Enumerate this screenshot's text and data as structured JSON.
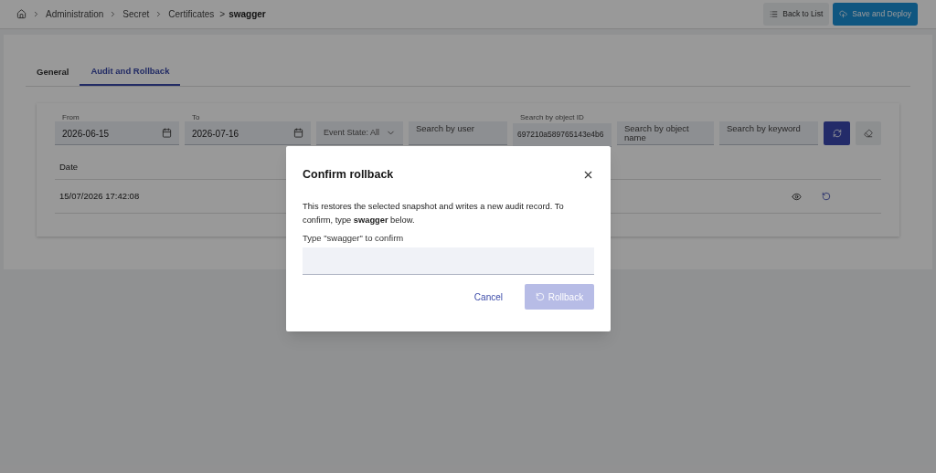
{
  "breadcrumb": {
    "items": [
      "Administration",
      "Secret",
      "Certificates"
    ],
    "separator": ">",
    "current": "swagger"
  },
  "header_buttons": [
    {
      "kind": "secondary",
      "label": "Back to List"
    },
    {
      "kind": "primary",
      "label": "Save and Deploy"
    }
  ],
  "tabs": [
    {
      "label": "General",
      "selected": false
    },
    {
      "label": "Audit and Rollback",
      "selected": true
    }
  ],
  "filters": [
    {
      "kind": "date",
      "label": "From",
      "value": "2026-06-15"
    },
    {
      "kind": "date",
      "label": "To",
      "value": "2026-07-16"
    },
    {
      "kind": "select",
      "value": "Event State: All"
    },
    {
      "kind": "text",
      "placeholder": "Search by user"
    },
    {
      "kind": "text",
      "label": "Search by object ID",
      "value": "697210a589765143e4b6"
    },
    {
      "kind": "text",
      "placeholder": "Search by object name"
    },
    {
      "kind": "text",
      "placeholder": "Search by keyword"
    }
  ],
  "table": {
    "columns": [
      "Date"
    ],
    "rows": [
      {
        "date": "15/07/2026 17:42:08"
      }
    ]
  },
  "dialog": {
    "title": "Confirm rollback",
    "message": "This restores the selected snapshot and writes a new audit record. To confirm, type **swagger** below.",
    "field_label": "Type \"swagger\" to confirm",
    "cancel": "Cancel",
    "confirm": {
      "label": "Rollback",
      "disabled": true
    }
  }
}
